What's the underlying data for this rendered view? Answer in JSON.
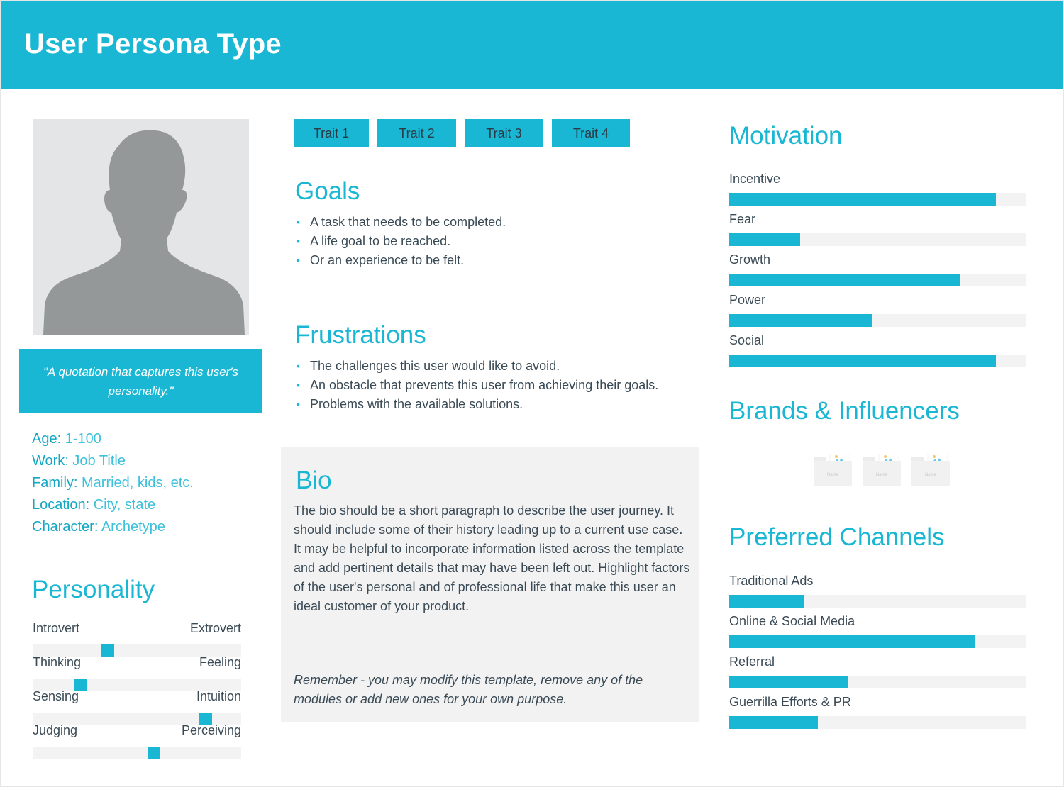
{
  "header": {
    "title": "User Persona Type"
  },
  "colors": {
    "accent": "#1ab7d4",
    "track": "#f3f3f3",
    "text": "#3a4a55",
    "bio_bg": "#f2f2f2",
    "avatar_bg": "#e3e5e7",
    "avatar_silhouette": "#949899"
  },
  "profile": {
    "avatar_icon": "user-silhouette-icon",
    "quote": "\"A quotation that captures this user's personality.\"",
    "facts": [
      {
        "key": "Age:",
        "value": " 1-100"
      },
      {
        "key": "Work",
        "value": ": Job Title"
      },
      {
        "key": "Family:",
        "value": " Married, kids, etc."
      },
      {
        "key": "Location:",
        "value": " City, state"
      },
      {
        "key": "Character:",
        "value": " Archetype"
      }
    ]
  },
  "personality": {
    "title": "Personality",
    "scales": [
      {
        "left": "Introvert",
        "right": "Extrovert",
        "position": 0.36
      },
      {
        "left": "Thinking",
        "right": "Feeling",
        "position": 0.23
      },
      {
        "left": "Sensing",
        "right": "Intuition",
        "position": 0.83
      },
      {
        "left": "Judging",
        "right": "Perceiving",
        "position": 0.58
      }
    ]
  },
  "traits": [
    "Trait 1",
    "Trait 2",
    "Trait 3",
    "Trait 4"
  ],
  "goals": {
    "title": "Goals",
    "items": [
      "A task that needs to be completed.",
      "A life goal to be reached.",
      "Or an experience to be felt."
    ]
  },
  "frustrations": {
    "title": "Frustrations",
    "items": [
      "The challenges this user would like to avoid.",
      "An obstacle that prevents this user from achieving their goals.",
      "Problems with the available solutions."
    ]
  },
  "bio": {
    "title": "Bio",
    "text": "The bio should be a short paragraph to describe the user journey. It should include some of their history leading up to a current use case. It may be helpful to incorporate information listed across the template and add pertinent details that may have been left out. Highlight factors of the user's personal and of professional life that make this user an ideal customer of your product.",
    "note": "Remember - you may modify this template, remove any of the modules or add new ones for your own purpose."
  },
  "motivation": {
    "title": "Motivation",
    "items": [
      {
        "label": "Incentive",
        "value": 0.9
      },
      {
        "label": "Fear",
        "value": 0.24
      },
      {
        "label": "Growth",
        "value": 0.78
      },
      {
        "label": "Power",
        "value": 0.48
      },
      {
        "label": "Social",
        "value": 0.9
      }
    ]
  },
  "brands": {
    "title": "Brands & Influencers",
    "items": [
      {
        "icon": "image-folder-icon",
        "name": "Name"
      },
      {
        "icon": "image-folder-icon",
        "name": "Name"
      },
      {
        "icon": "image-folder-icon",
        "name": "Name"
      }
    ]
  },
  "channels": {
    "title": "Preferred Channels",
    "items": [
      {
        "label": "Traditional Ads",
        "value": 0.25
      },
      {
        "label": "Online & Social Media",
        "value": 0.83
      },
      {
        "label": "Referral",
        "value": 0.4
      },
      {
        "label": "Guerrilla Efforts & PR",
        "value": 0.3
      }
    ]
  }
}
